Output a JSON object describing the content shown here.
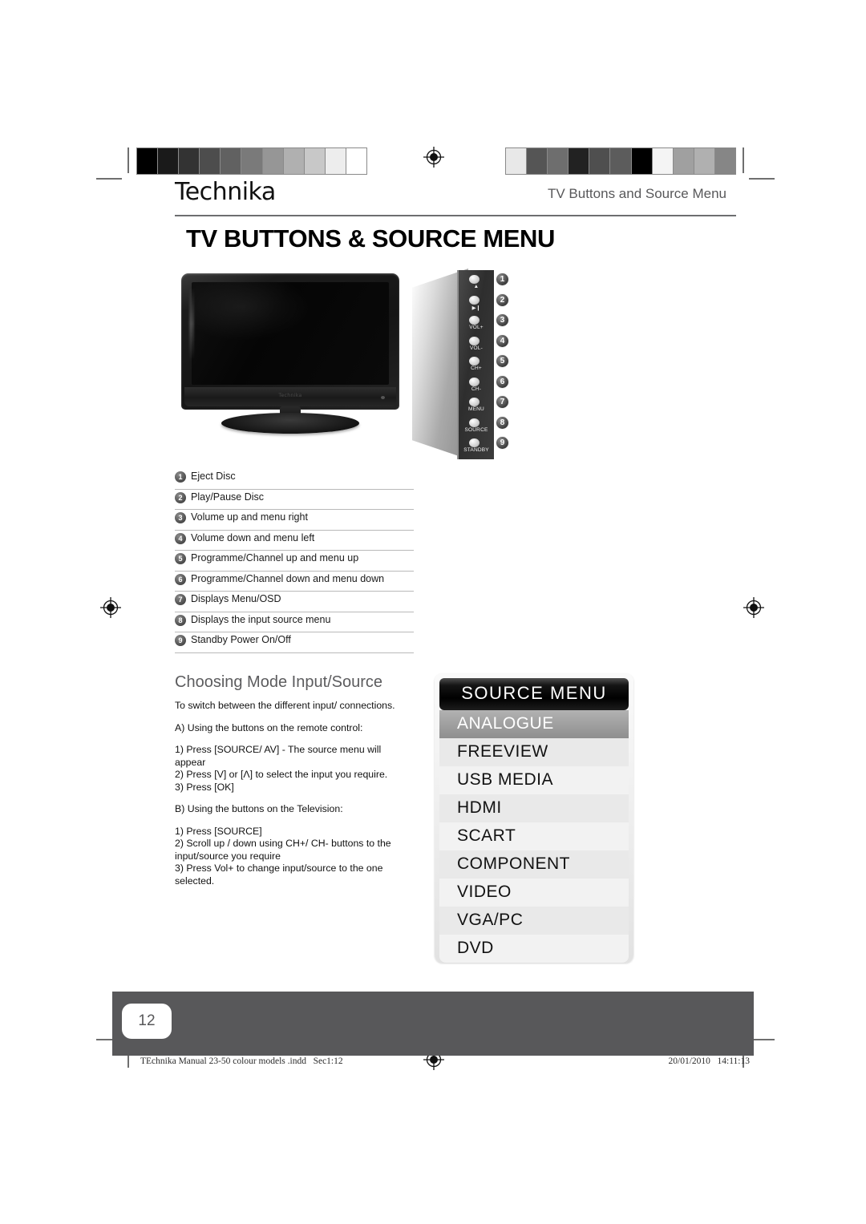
{
  "header": {
    "brand": "Technika",
    "section_title": "TV Buttons and Source Menu",
    "page_title": "TV BUTTONS & SOURCE MENU"
  },
  "tv_panel": {
    "chin_logo": "Technika",
    "buttons": [
      {
        "num": "1",
        "label": "▲"
      },
      {
        "num": "2",
        "label": "▶❙"
      },
      {
        "num": "3",
        "label": "VOL+"
      },
      {
        "num": "4",
        "label": "VOL-"
      },
      {
        "num": "5",
        "label": "CH+"
      },
      {
        "num": "6",
        "label": "CH-"
      },
      {
        "num": "7",
        "label": "MENU"
      },
      {
        "num": "8",
        "label": "SOURCE"
      },
      {
        "num": "9",
        "label": "STANDBY"
      }
    ]
  },
  "legend": [
    {
      "num": "1",
      "text": "Eject Disc"
    },
    {
      "num": "2",
      "text": "Play/Pause Disc"
    },
    {
      "num": "3",
      "text": "Volume up and menu right"
    },
    {
      "num": "4",
      "text": "Volume down and menu left"
    },
    {
      "num": "5",
      "text": "Programme/Channel up and menu up"
    },
    {
      "num": "6",
      "text": "Programme/Channel down and menu down"
    },
    {
      "num": "7",
      "text": "Displays Menu/OSD"
    },
    {
      "num": "8",
      "text": "Displays the input source menu"
    },
    {
      "num": "9",
      "text": "Standby Power On/Off"
    }
  ],
  "choosing": {
    "heading": "Choosing Mode Input/Source",
    "intro": "To switch between the different input/ connections.",
    "section_a": "A) Using the buttons on the remote control:",
    "a_steps": "1) Press [SOURCE/ AV] - The source menu will appear\n2) Press [V] or [Λ] to select the input you require.\n3) Press [OK]",
    "section_b": "B) Using the buttons on the Television:",
    "b_steps": "1) Press [SOURCE]\n2) Scroll up / down using CH+/ CH- buttons to the input/source you require\n3) Press Vol+ to change input/source to the one selected."
  },
  "source_menu": {
    "title": "SOURCE MENU",
    "items": [
      {
        "label": "ANALOGUE",
        "selected": true
      },
      {
        "label": "FREEVIEW",
        "selected": false
      },
      {
        "label": "USB MEDIA",
        "selected": false
      },
      {
        "label": "HDMI",
        "selected": false
      },
      {
        "label": "SCART",
        "selected": false
      },
      {
        "label": "COMPONENT",
        "selected": false
      },
      {
        "label": "VIDEO",
        "selected": false
      },
      {
        "label": "VGA/PC",
        "selected": false
      },
      {
        "label": "DVD",
        "selected": false
      }
    ]
  },
  "footer": {
    "page_number": "12",
    "file_info": "TEchnika Manual 23-50 colour models .indd   Sec1:12",
    "timestamp": "20/01/2010   14:11:13"
  },
  "calibration": {
    "left_bar": [
      "#000000",
      "#1a1a1a",
      "#333333",
      "#4d4d4d",
      "#616161",
      "#7a7a7a",
      "#969696",
      "#b0b0b0",
      "#c8c8c8",
      "#ededed",
      "#ffffff"
    ],
    "right_bar": [
      "#e8e8e8",
      "#555555",
      "#6e6e6e",
      "#222222",
      "#4f4f4f",
      "#5c5c5c",
      "#000000",
      "#f4f4f4",
      "#a0a0a0",
      "#b0b0b0",
      "#868686"
    ]
  }
}
